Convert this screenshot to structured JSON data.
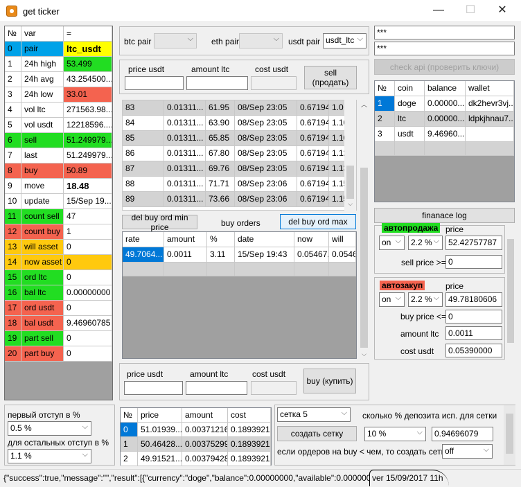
{
  "window": {
    "title": "get ticker",
    "min": "—",
    "max": "☐",
    "close": "✕"
  },
  "vars": {
    "headers": [
      "№",
      "var",
      "="
    ],
    "rows": [
      {
        "n": "0",
        "name": "pair",
        "value": "ltc_usdt",
        "c1": "#00a2e8",
        "c2": "#ffff00",
        "bold": true
      },
      {
        "n": "1",
        "name": "24h high",
        "value": "53.499",
        "c1": "#fff",
        "c2": "#22dd22"
      },
      {
        "n": "2",
        "name": "24h avg",
        "value": "43.254500...",
        "c1": "#fff",
        "c2": "#fff"
      },
      {
        "n": "3",
        "name": "24h low",
        "value": "33.01",
        "c1": "#fff",
        "c2": "#f4634f"
      },
      {
        "n": "4",
        "name": "vol ltc",
        "value": "271563.98...",
        "c1": "#fff",
        "c2": "#fff"
      },
      {
        "n": "5",
        "name": "vol usdt",
        "value": "12218596....",
        "c1": "#fff",
        "c2": "#fff"
      },
      {
        "n": "6",
        "name": "sell",
        "value": "51.249979...",
        "c1": "#22dd22",
        "c2": "#22dd22"
      },
      {
        "n": "7",
        "name": "last",
        "value": "51.249979...",
        "c1": "#fff",
        "c2": "#fff"
      },
      {
        "n": "8",
        "name": "buy",
        "value": "50.89",
        "c1": "#f4634f",
        "c2": "#f4634f"
      },
      {
        "n": "9",
        "name": "move",
        "value": "18.48",
        "c1": "#fff",
        "c2": "#fff",
        "bold": true
      },
      {
        "n": "10",
        "name": "update",
        "value": "15/Sep 19...",
        "c1": "#fff",
        "c2": "#fff"
      },
      {
        "n": "11",
        "name": "count sell",
        "value": "47",
        "c1": "#22dd22",
        "c2": "#fff"
      },
      {
        "n": "12",
        "name": "count buy",
        "value": "1",
        "c1": "#f4634f",
        "c2": "#fff"
      },
      {
        "n": "13",
        "name": "will asset",
        "value": "0",
        "c1": "#ffc90e",
        "c2": "#fff"
      },
      {
        "n": "14",
        "name": "now asset",
        "value": "0",
        "c1": "#ffc90e",
        "c2": "#ffc90e"
      },
      {
        "n": "15",
        "name": "ord ltc",
        "value": "0",
        "c1": "#22dd22",
        "c2": "#fff"
      },
      {
        "n": "16",
        "name": "bal ltc",
        "value": "0.00000000",
        "c1": "#22dd22",
        "c2": "#fff"
      },
      {
        "n": "17",
        "name": "ord usdt",
        "value": "0",
        "c1": "#f4634f",
        "c2": "#fff"
      },
      {
        "n": "18",
        "name": "bal usdt",
        "value": "9.46960785",
        "c1": "#f4634f",
        "c2": "#fff"
      },
      {
        "n": "19",
        "name": "part sell",
        "value": "0",
        "c1": "#22dd22",
        "c2": "#fff"
      },
      {
        "n": "20",
        "name": "part buy",
        "value": "0",
        "c1": "#f4634f",
        "c2": "#fff"
      }
    ]
  },
  "pairs": {
    "btc_label": "btc pair",
    "btc_value": "",
    "eth_label": "eth pair",
    "eth_value": "",
    "usdt_label": "usdt pair",
    "usdt_value": "usdt_ltc"
  },
  "sell_form": {
    "price_label": "price usdt",
    "amount_label": "amount ltc",
    "cost_label": "cost usdt",
    "button": "sell\n(продать)"
  },
  "sell_orders": {
    "rows": [
      [
        "83",
        "0.01311...",
        "61.95",
        "08/Sep 23:05",
        "0.67194...",
        "1.0"
      ],
      [
        "84",
        "0.01311...",
        "63.90",
        "08/Sep 23:05",
        "0.67194...",
        "1.10"
      ],
      [
        "85",
        "0.01311...",
        "65.85",
        "08/Sep 23:05",
        "0.67194...",
        "1.10"
      ],
      [
        "86",
        "0.01311...",
        "67.80",
        "08/Sep 23:05",
        "0.67194...",
        "1.12"
      ],
      [
        "87",
        "0.01311...",
        "69.76",
        "08/Sep 23:05",
        "0.67194...",
        "1.13"
      ],
      [
        "88",
        "0.01311...",
        "71.71",
        "08/Sep 23:06",
        "0.67194...",
        "1.15"
      ],
      [
        "89",
        "0.01311...",
        "73.66",
        "08/Sep 23:06",
        "0.67194...",
        "1.15"
      ]
    ]
  },
  "buy_orders": {
    "del_min": "del buy ord min price",
    "title": "buy orders",
    "del_max": "del buy ord max",
    "headers": [
      "rate",
      "amount",
      "%",
      "date",
      "now",
      "will"
    ],
    "rows": [
      [
        "49.7064...",
        "0.0011",
        "3.11",
        "15/Sep 19:43",
        "0.05467...",
        "0.0546"
      ]
    ]
  },
  "buy_form": {
    "price_label": "price usdt",
    "amount_label": "amount ltc",
    "cost_label": "cost usdt",
    "button": "buy (купить)"
  },
  "api": {
    "key": "***",
    "secret": "***",
    "check_button": "check api (проверить ключи)"
  },
  "balances": {
    "headers": [
      "№",
      "coin",
      "balance",
      "wallet"
    ],
    "rows": [
      [
        "1",
        "doge",
        "0.00000...",
        "dk2hevr3vj..."
      ],
      [
        "2",
        "ltc",
        "0.00000...",
        "ldpkjhnau7..."
      ],
      [
        "3",
        "usdt",
        "9.46960...",
        ""
      ]
    ]
  },
  "log_button": "finanace log",
  "autosell": {
    "title": "автопродажа",
    "price_label": "price",
    "mode": "on",
    "pct": "2.2 %",
    "price": "52.42757787",
    "cond_label": "sell price >=",
    "cond_value": "0"
  },
  "autobuy": {
    "title": "автозакуп",
    "price_label": "price",
    "mode": "on",
    "pct": "2.2 %",
    "price": "49.78180606",
    "cond_label": "buy price <=",
    "cond_value": "0",
    "amount_label": "amount ltc",
    "amount_value": "0.0011",
    "cost_label": "cost usdt",
    "cost_value": "0.05390000"
  },
  "offsets": {
    "first_label": "первый отступ в %",
    "first_value": "0.5 %",
    "other_label": "для остальных отступ в %",
    "other_value": "1.1 %"
  },
  "grid": {
    "headers": [
      "№",
      "price",
      "amount",
      "cost"
    ],
    "rows": [
      [
        "0",
        "51.01939...",
        "0.00371216",
        "0.18939216"
      ],
      [
        "1",
        "50.46428...",
        "0.00375299",
        "0.18939216"
      ],
      [
        "2",
        "49.91521...",
        "0.00379428",
        "0.18939216"
      ]
    ]
  },
  "grid_ctrl": {
    "setka": "сетка 5",
    "create_button": "создать сетку",
    "pct_label": "сколько % депозита исп. для сетки",
    "pct_value": "10 %",
    "amount_value": "0.94696079",
    "cond_label": "если ордеров на buy < чем, то создать сетку",
    "cond_value": "off"
  },
  "status": {
    "json": "{\"success\":true,\"message\":\"\",\"result\":[{\"currency\":\"doge\",\"balance\":0.00000000,\"available\":0.00000000",
    "version": "ver 15/09/2017 11h"
  }
}
